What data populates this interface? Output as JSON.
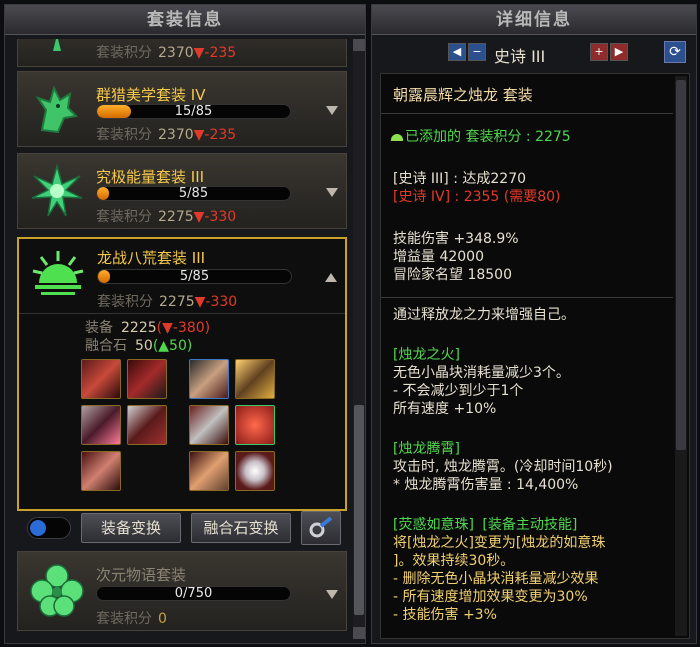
{
  "left_panel": {
    "title": "套装信息",
    "partial_top": {
      "label": "套装积分",
      "score": "2370",
      "delta": "▼-235"
    },
    "sets": [
      {
        "name": "群猎美学套装 IV",
        "progress": "15/85",
        "progress_fraction": 0.176,
        "score_label": "套装积分",
        "score": "2370",
        "delta": "▼-235",
        "icon": "wolf-icon"
      },
      {
        "name": "究极能量套装 III",
        "progress": "5/85",
        "progress_fraction": 0.06,
        "score_label": "套装积分",
        "score": "2275",
        "delta": "▼-330",
        "icon": "starburst-icon"
      },
      {
        "name": "龙战八荒套装 III",
        "progress": "5/85",
        "progress_fraction": 0.06,
        "score_label": "套装积分",
        "score": "2275",
        "delta": "▼-330",
        "icon": "sunrise-icon",
        "details": {
          "equip_label": "装备",
          "equip_value": "2225",
          "equip_delta": "(▼-380)",
          "stone_label": "融合石",
          "stone_value": "50",
          "stone_delta": "(▲50)"
        }
      },
      {
        "name": "次元物语套装",
        "progress": "0/750",
        "progress_fraction": 0,
        "score_label": "套装积分",
        "score": "0",
        "icon": "clover-icon"
      }
    ],
    "buttons": {
      "equip_switch": "装备变换",
      "stone_switch": "融合石变换"
    }
  },
  "right_panel": {
    "title": "详细信息",
    "rank": "史诗 III",
    "set_title": "朝露晨辉之烛龙 套装",
    "added_label": "已添加的 套装积分 : 2275",
    "req_achieved": "[史诗 III] : 达成2270",
    "req_next": "[史诗 IV] : 2355 (需要80)",
    "stats": [
      "技能伤害 +348.9%",
      "增益量 42000",
      "冒险家名望 18500"
    ],
    "description": "通过释放龙之力来增强自己。",
    "effect1": {
      "title": "[烛龙之火]",
      "lines": [
        "无色小晶块消耗量减少3个。",
        "- 不会减少到少于1个",
        "所有速度 +10%"
      ]
    },
    "effect2": {
      "title": "[烛龙腾霄]",
      "lines": [
        "攻击时, 烛龙腾霄。(冷却时间10秒)",
        "* 烛龙腾霄伤害量 : 14,400%"
      ]
    },
    "effect3": {
      "title": "[荧惑如意珠]",
      "tag": "[装备主动技能]",
      "lines": [
        "将[烛龙之火]变更为[烛龙的如意珠",
        "]。效果持续30秒。",
        "- 删除无色小晶块消耗量减少效果",
        "- 所有速度增加效果变更为30%",
        "- 技能伤害 +3%"
      ]
    }
  },
  "colors": {
    "gold": "#f5c84a",
    "red": "#e23a2a",
    "green": "#4fd84f",
    "frame": "#c9a227"
  }
}
